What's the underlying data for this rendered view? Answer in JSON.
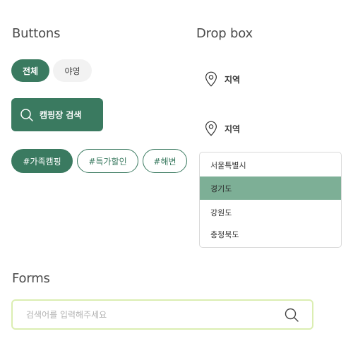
{
  "buttons": {
    "title": "Buttons",
    "toggle": {
      "all_label": "전체",
      "night_label": "야영"
    },
    "search_label": "캠핑장 검색",
    "tags": [
      "#가족캠핑",
      "#특가할인",
      "#해변"
    ]
  },
  "dropbox": {
    "title": "Drop box",
    "region_label_1": "지역",
    "region_label_2": "지역",
    "options": [
      "서울특별시",
      "경기도",
      "강원도",
      "충청북도"
    ],
    "selected": "경기도"
  },
  "forms": {
    "title": "Forms",
    "search_placeholder": "검색어를 입력해주세요"
  },
  "colors": {
    "primary": "#3a7a60",
    "selected_option": "#7daf96",
    "inactive_pill": "#f2f2f2",
    "form_border": "#dbeeb2"
  },
  "icons": {
    "search": "search-icon",
    "location": "map-pin-icon"
  }
}
